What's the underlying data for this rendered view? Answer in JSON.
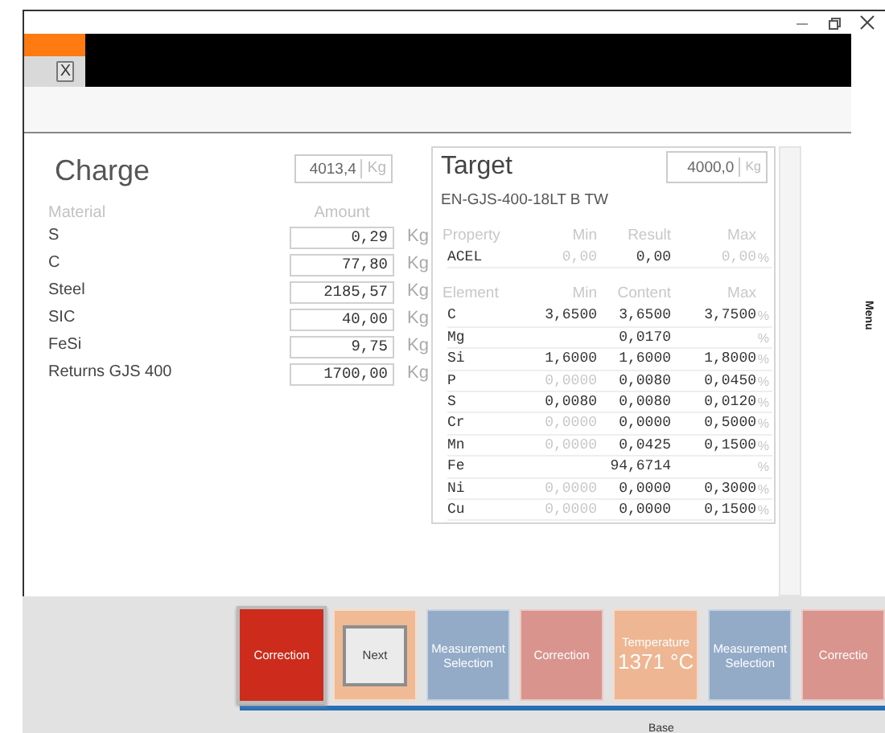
{
  "tabs": [
    {
      "close_label": "X",
      "selected": true
    }
  ],
  "charge": {
    "title": "Charge",
    "total": "4013,4",
    "total_unit": "Kg",
    "columns": [
      "Material",
      "Amount"
    ],
    "rows": [
      {
        "material": "S",
        "amount": "0,29",
        "unit": "Kg"
      },
      {
        "material": "C",
        "amount": "77,80",
        "unit": "Kg"
      },
      {
        "material": "Steel",
        "amount": "2185,57",
        "unit": "Kg"
      },
      {
        "material": "SIC",
        "amount": "40,00",
        "unit": "Kg"
      },
      {
        "material": "FeSi",
        "amount": "9,75",
        "unit": "Kg"
      },
      {
        "material": "Returns GJS 400",
        "amount": "1700,00",
        "unit": "Kg"
      }
    ]
  },
  "target": {
    "title": "Target",
    "total": "4000,0",
    "total_unit": "Kg",
    "grade": "EN-GJS-400-18LT B TW",
    "property_columns": [
      "Property",
      "Min",
      "Result",
      "Max"
    ],
    "properties": [
      {
        "name": "ACEL",
        "min": "0,00",
        "value": "0,00",
        "max": "0,00",
        "unit": "%",
        "min_muted": true,
        "max_muted": true
      }
    ],
    "element_columns": [
      "Element",
      "Min",
      "Content",
      "Max"
    ],
    "elements": [
      {
        "name": "C",
        "min": "3,6500",
        "value": "3,6500",
        "max": "3,7500",
        "unit": "%",
        "min_muted": false,
        "max_muted": false
      },
      {
        "name": "Mg",
        "value": "0,0170",
        "unit": "%"
      },
      {
        "name": "Si",
        "min": "1,6000",
        "value": "1,6000",
        "max": "1,8000",
        "unit": "%",
        "min_muted": false,
        "max_muted": false
      },
      {
        "name": "P",
        "min": "0,0000",
        "value": "0,0080",
        "max": "0,0450",
        "unit": "%",
        "min_muted": true,
        "max_muted": false
      },
      {
        "name": "S",
        "min": "0,0080",
        "value": "0,0080",
        "max": "0,0120",
        "unit": "%",
        "min_muted": false,
        "max_muted": false
      },
      {
        "name": "Cr",
        "min": "0,0000",
        "value": "0,0000",
        "max": "0,5000",
        "unit": "%",
        "min_muted": true,
        "max_muted": false
      },
      {
        "name": "Mn",
        "min": "0,0000",
        "value": "0,0425",
        "max": "0,1500",
        "unit": "%",
        "min_muted": true,
        "max_muted": false
      },
      {
        "name": "Fe",
        "value": "94,6714",
        "unit": "%"
      },
      {
        "name": "Ni",
        "min": "0,0000",
        "value": "0,0000",
        "max": "0,3000",
        "unit": "%",
        "min_muted": true,
        "max_muted": false
      },
      {
        "name": "Cu",
        "min": "0,0000",
        "value": "0,0000",
        "max": "0,1500",
        "unit": "%",
        "min_muted": true,
        "max_muted": false
      }
    ]
  },
  "side_menu": {
    "label": "Menu"
  },
  "steps": [
    {
      "kind": "action",
      "label": "Correction",
      "color": "#cc2211",
      "selected": true
    },
    {
      "kind": "button",
      "label": "Next",
      "color": "#f0b890",
      "selected": false
    },
    {
      "kind": "action",
      "label": "Measurement Selection",
      "color": "#8fa9c6",
      "selected": false
    },
    {
      "kind": "action",
      "label": "Correction",
      "color": "#d9908a",
      "selected": false
    },
    {
      "kind": "reading",
      "label": "Temperature",
      "value": "1371 °C",
      "color": "#efb48e",
      "selected": false
    },
    {
      "kind": "action",
      "label": "Measurement Selection",
      "color": "#8fa9c6",
      "selected": false
    },
    {
      "kind": "action",
      "label": "Correctio",
      "color": "#d9908a",
      "selected": false
    }
  ],
  "stage": {
    "label": "Base"
  }
}
